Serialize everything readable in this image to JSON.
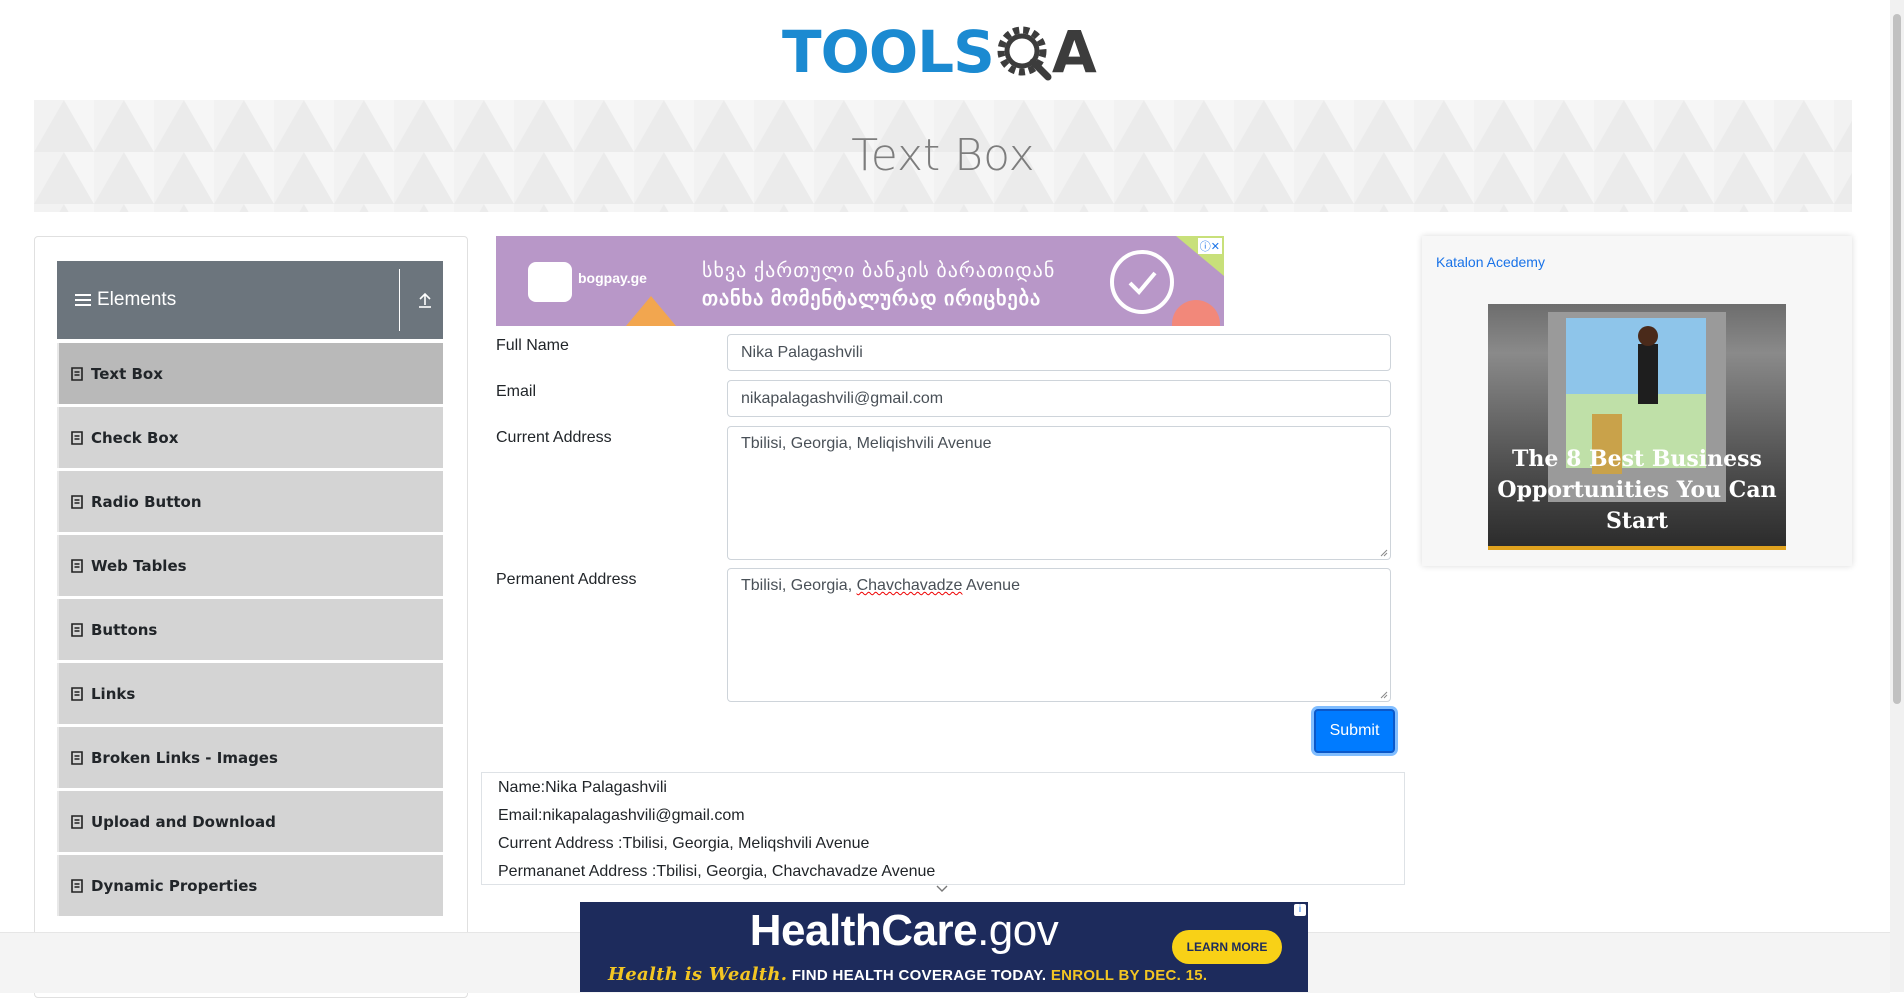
{
  "header": {
    "logo_text_tools": "TOOLS",
    "logo_text_a": "A",
    "title": "Text Box"
  },
  "sidebar": {
    "group_title": "Elements",
    "items": [
      {
        "label": "Text Box",
        "active": true
      },
      {
        "label": "Check Box"
      },
      {
        "label": "Radio Button"
      },
      {
        "label": "Web Tables"
      },
      {
        "label": "Buttons"
      },
      {
        "label": "Links"
      },
      {
        "label": "Broken Links - Images"
      },
      {
        "label": "Upload and Download"
      },
      {
        "label": "Dynamic Properties"
      }
    ]
  },
  "ad_top": {
    "brand": "bogpay.ge",
    "line1": "სხვა ქართული ბანკის ბარათიდან",
    "line2": "თანხა მომენტალურად ირიცხება"
  },
  "form": {
    "full_name_label": "Full Name",
    "full_name_value": "Nika Palagashvili",
    "email_label": "Email",
    "email_value": "nikapalagashvili@gmail.com",
    "current_address_label": "Current Address",
    "current_address_value": "Tbilisi, Georgia, Meliqishvili Avenue",
    "permanent_address_label": "Permanent Address",
    "permanent_address_prefix": "Tbilisi, Georgia, ",
    "permanent_address_misspelled": "Chavchavadze",
    "permanent_address_suffix": " Avenue",
    "submit_label": "Submit"
  },
  "output": {
    "name": "Name:Nika Palagashvili",
    "email": "Email:nikapalagashvili@gmail.com",
    "current_address": "Current Address :Tbilisi, Georgia, Meliqshvili Avenue",
    "permanent_address": "Permananet Address :Tbilisi, Georgia, Chavchavadze Avenue"
  },
  "right_ad": {
    "link_text": "Katalon Acedemy",
    "caption": "The 8 Best Business Opportunities You Can Start"
  },
  "ad_bottom": {
    "title_main": "HealthCare",
    "title_suffix": ".gov",
    "tagline_script": "Health is Wealth.",
    "tagline_white": "FIND HEALTH COVERAGE TODAY.",
    "tagline_yellow": "ENROLL BY DEC. 15.",
    "button": "LEARN MORE"
  },
  "colors": {
    "accent": "#007bff",
    "sidebar_header": "#6c757d",
    "menu_item": "#d4d4d4",
    "menu_active": "#b9b9b9"
  }
}
